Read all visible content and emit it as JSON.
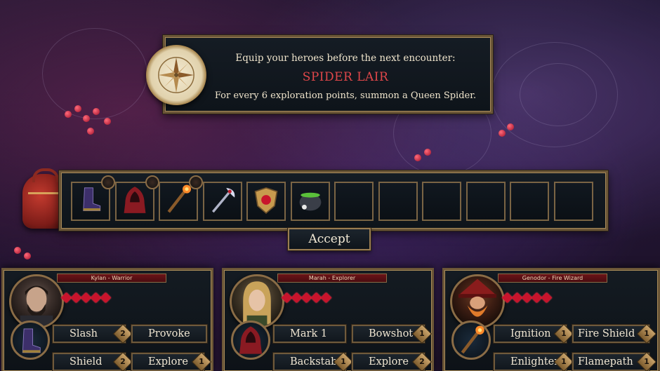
{
  "banner": {
    "line1": "Equip your heroes before the next encounter:",
    "title": "SPIDER LAIR",
    "line3": "For every 6 exploration points, summon a Queen Spider."
  },
  "inventory": {
    "slots": [
      {
        "icon": "boots-icon",
        "has_owner": true
      },
      {
        "icon": "red-hood-icon",
        "has_owner": true
      },
      {
        "icon": "fire-staff-icon",
        "has_owner": true
      },
      {
        "icon": "battle-axe-icon",
        "has_owner": false
      },
      {
        "icon": "ruby-shield-icon",
        "has_owner": false
      },
      {
        "icon": "cauldron-icon",
        "has_owner": false
      },
      {
        "icon": "empty",
        "has_owner": false
      },
      {
        "icon": "empty",
        "has_owner": false
      },
      {
        "icon": "empty",
        "has_owner": false
      },
      {
        "icon": "empty",
        "has_owner": false
      },
      {
        "icon": "empty",
        "has_owner": false
      },
      {
        "icon": "empty",
        "has_owner": false
      }
    ]
  },
  "accept_label": "Accept",
  "heroes": [
    {
      "name": "Kylan - Warrior",
      "hearts": 5,
      "skills": [
        {
          "label": "Slash",
          "cost": "2"
        },
        {
          "label": "Provoke",
          "cost": ""
        },
        {
          "label": "Shield",
          "cost": "2"
        },
        {
          "label": "Explore",
          "cost": "1"
        }
      ]
    },
    {
      "name": "Marah - Explorer",
      "hearts": 5,
      "skills": [
        {
          "label": "Mark 1",
          "cost": ""
        },
        {
          "label": "Bowshot",
          "cost": "1"
        },
        {
          "label": "Backstab",
          "cost": "1"
        },
        {
          "label": "Explore",
          "cost": "2"
        }
      ]
    },
    {
      "name": "Genodor - Fire Wizard",
      "hearts": 5,
      "skills": [
        {
          "label": "Ignition",
          "cost": "1"
        },
        {
          "label": "Fire Shield",
          "cost": "1"
        },
        {
          "label": "Enlighten",
          "cost": "1"
        },
        {
          "label": "Flamepath",
          "cost": "1"
        }
      ]
    }
  ],
  "colors": {
    "accent_red": "#e0474a",
    "frame_gold": "#a88b5a",
    "heart_red": "#c8142c"
  }
}
